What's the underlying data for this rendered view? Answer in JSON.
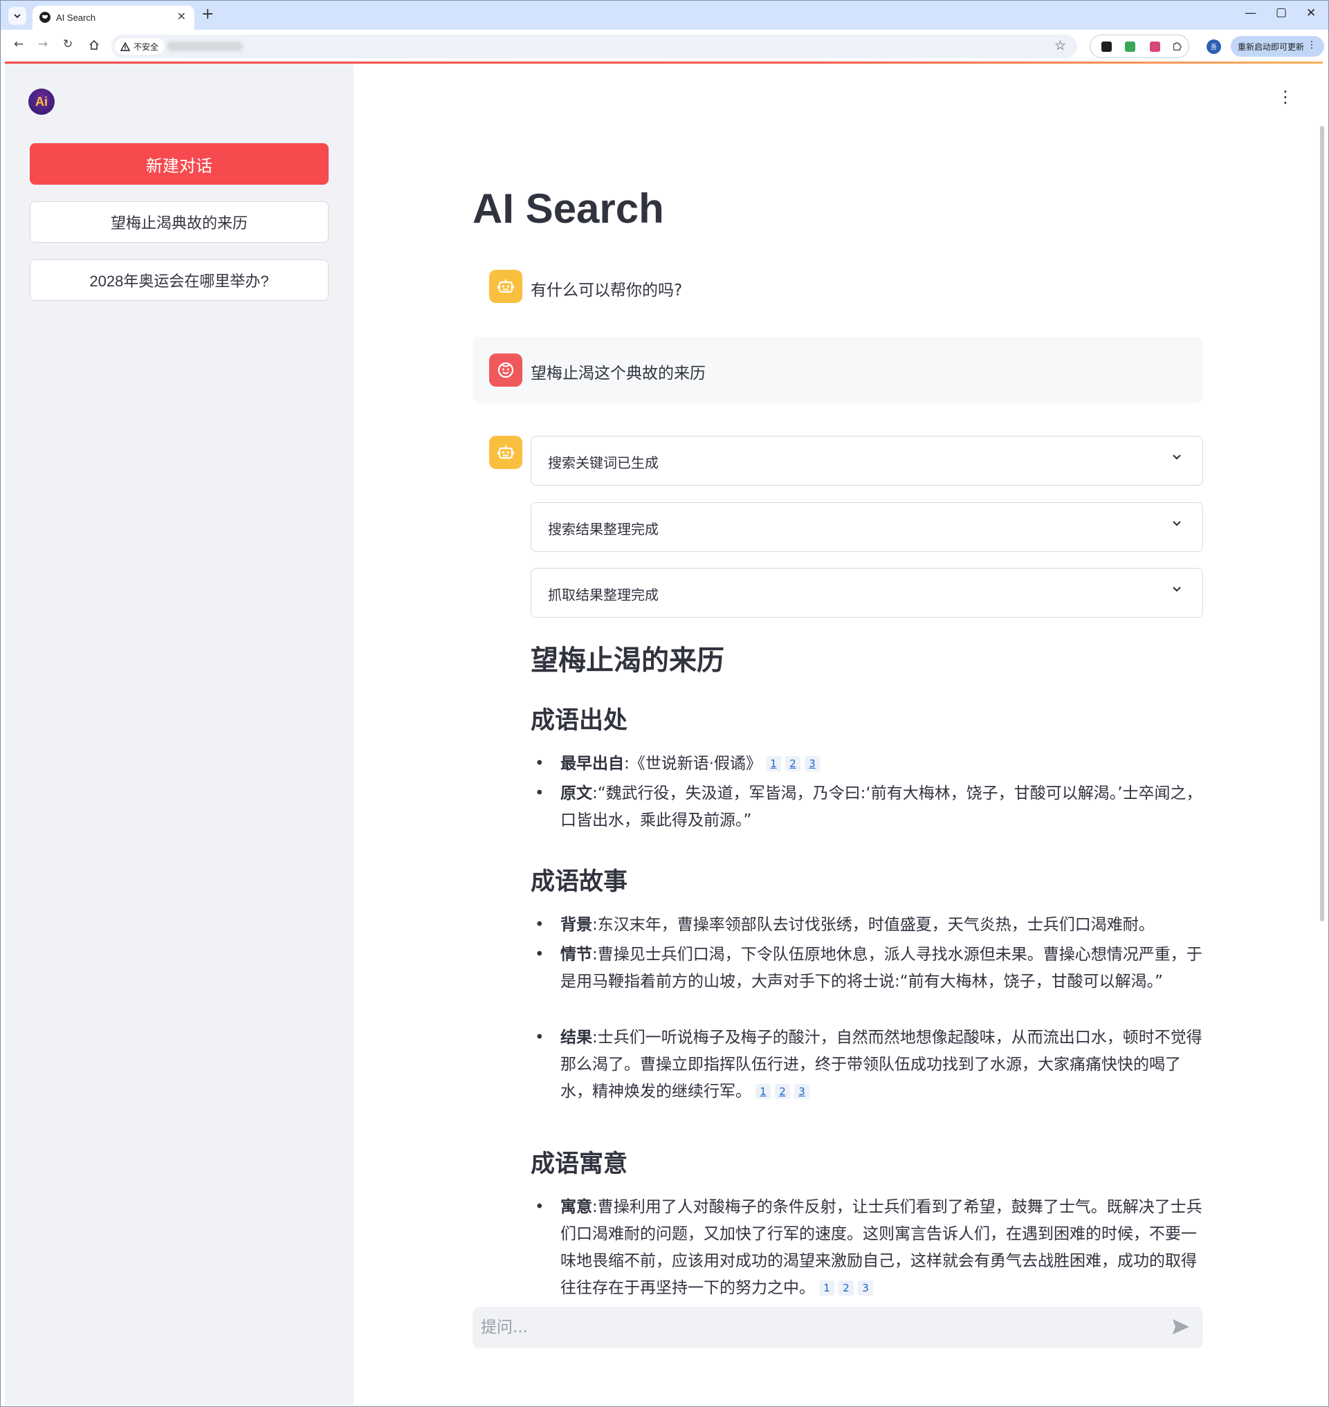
{
  "browser": {
    "tab_title": "AI Search",
    "security_label": "不安全",
    "update_label": "重新启动即可更新",
    "profile_initial": "吾"
  },
  "sidebar": {
    "logo_text": "Ai",
    "new_chat_label": "新建对话",
    "history": [
      {
        "label": "望梅止渴典故的来历"
      },
      {
        "label": "2028年奥运会在哪里举办?"
      }
    ]
  },
  "main": {
    "title": "AI Search",
    "greeting": "有什么可以帮你的吗?",
    "user_question": "望梅止渴这个典故的来历",
    "steps": [
      {
        "label": "搜索关键词已生成"
      },
      {
        "label": "搜索结果整理完成"
      },
      {
        "label": "抓取结果整理完成"
      }
    ],
    "answer": {
      "title": "望梅止渴的来历",
      "sections": [
        {
          "heading": "成语出处",
          "items": [
            {
              "term": "最早出自",
              "sep": ":",
              "text": "《世说新语·假谲》",
              "cites": [
                "1",
                "2",
                "3"
              ]
            },
            {
              "term": "原文",
              "sep": ":",
              "text": "“魏武行役，失汲道，军皆渴，乃令曰:‘前有大梅林，饶子，甘酸可以解渴。’士卒闻之，口皆出水，乘此得及前源。”",
              "cites": []
            }
          ]
        },
        {
          "heading": "成语故事",
          "items": [
            {
              "term": "背景",
              "sep": ":",
              "text": "东汉末年，曹操率领部队去讨伐张绣，时值盛夏，天气炎热，士兵们口渴难耐。",
              "cites": []
            },
            {
              "term": "情节",
              "sep": ":",
              "text": "曹操见士兵们口渴，下令队伍原地休息，派人寻找水源但未果。曹操心想情况严重，于是用马鞭指着前方的山坡，大声对手下的将士说:“前有大梅林，饶子，甘酸可以解渴。”",
              "cites": []
            },
            {
              "term": "结果",
              "sep": ":",
              "text": "士兵们一听说梅子及梅子的酸汁，自然而然地想像起酸味，从而流出口水，顿时不觉得那么渴了。曹操立即指挥队伍行进，终于带领队伍成功找到了水源，大家痛痛快快的喝了水，精神焕发的继续行军。",
              "cites": [
                "1",
                "2",
                "3"
              ]
            }
          ]
        },
        {
          "heading": "成语寓意",
          "items": [
            {
              "term": "寓意",
              "sep": ":",
              "text": "曹操利用了人对酸梅子的条件反射，让士兵们看到了希望，鼓舞了士气。既解决了士兵们口渴难耐的问题，又加快了行军的速度。这则寓言告诉人们，在遇到困难的时候，不要一味地畏缩不前，应该用对成功的渴望来激励自己，这样就会有勇气去战胜困难，成功的取得往往存在于再坚持一下的努力之中。",
              "cites": [
                "1",
                "2",
                "3"
              ]
            }
          ]
        }
      ]
    },
    "input_placeholder": "提问..."
  },
  "colors": {
    "accent": "#f64a4e",
    "bot_avatar": "#f9bf3f",
    "user_avatar": "#f0595b",
    "sidebar_bg": "#f0f2f6"
  }
}
